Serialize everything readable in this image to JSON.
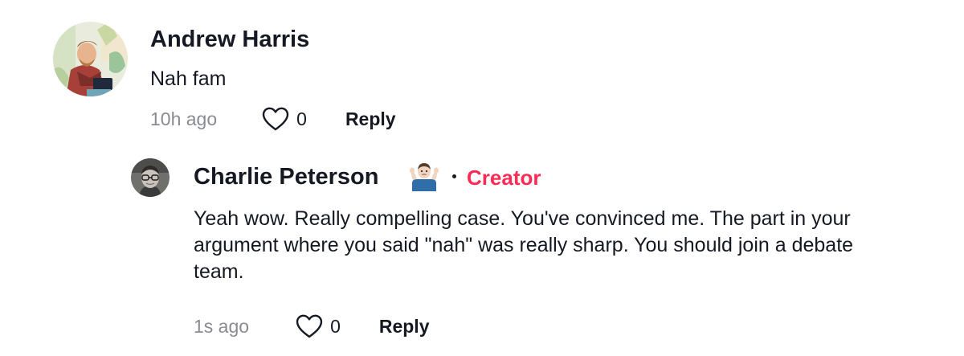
{
  "comments": [
    {
      "username": "Andrew Harris",
      "avatar_icon": "avatar-illustrated-man",
      "text": "Nah fam",
      "time": "10h ago",
      "likes": "0",
      "reply_label": "Reply"
    }
  ],
  "reply": {
    "username": "Charlie Peterson",
    "avatar_icon": "avatar-photo-man-glasses",
    "emoji_icon": "person-shrugging-emoji",
    "badge": "Creator",
    "text": "Yeah wow. Really compelling case. You've convinced me. The part in your argument where you said \"nah\" was really sharp. You should join a debate team.",
    "time": "1s ago",
    "likes": "0",
    "reply_label": "Reply"
  },
  "colors": {
    "text": "#161823",
    "muted": "#8a8b91",
    "accent": "#fe2c55"
  }
}
